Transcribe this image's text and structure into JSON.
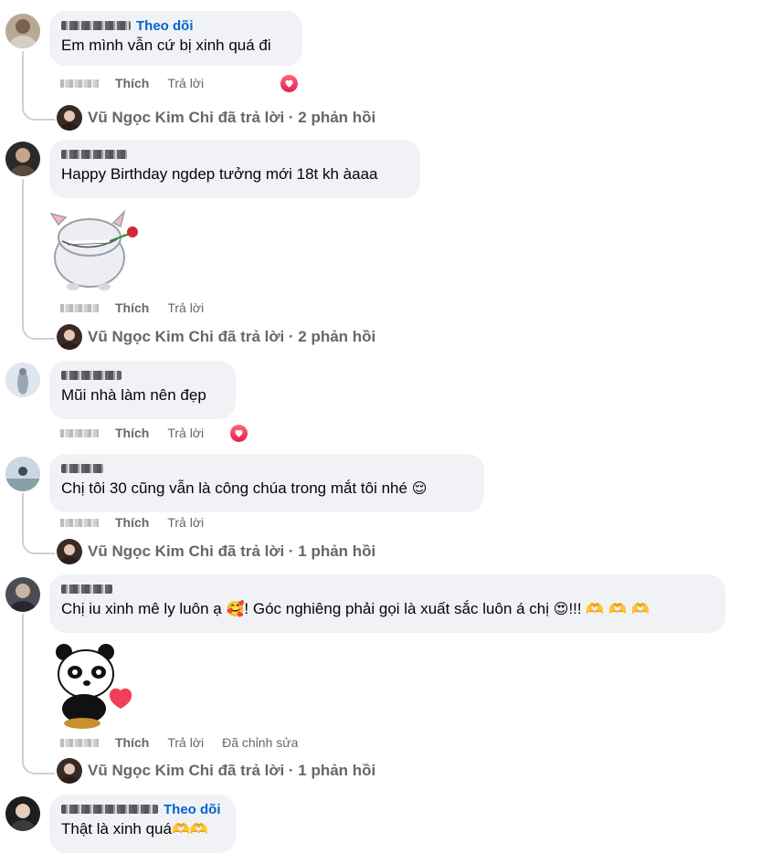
{
  "comments": [
    {
      "text": "Em mình vẫn cứ bị xinh quá đi",
      "follow": "Theo dõi",
      "like": "Thích",
      "reply": "Trả lời"
    },
    {
      "text": "Happy Birthday ngdep tưởng mới 18t kh àaaa",
      "like": "Thích",
      "reply": "Trả lời"
    },
    {
      "text": "Mũi nhà làm nên đẹp",
      "like": "Thích",
      "reply": "Trả lời"
    },
    {
      "text": "Chị tôi 30 cũng vẫn là công chúa trong mắt tôi nhé",
      "emoji": "😌",
      "like": "Thích",
      "reply": "Trả lời"
    },
    {
      "text_a": "Chị iu xinh mê ly luôn ạ",
      "emoji_a": "🥰",
      "text_b": "! Góc nghiêng phải gọi là xuất sắc luôn á chị",
      "emoji_b": "😍",
      "text_c": "!!!",
      "emoji_c": "🫶 🫶 🫶",
      "like": "Thích",
      "reply": "Trả lời",
      "edited": "Đã chỉnh sửa"
    },
    {
      "text": "Thật là xinh quá",
      "emoji": "🫶🫶",
      "follow": "Theo dõi"
    }
  ],
  "replies": [
    {
      "label": "Vũ Ngọc Kim Chi đã trả lời · 2 phản hồi"
    },
    {
      "label": "Vũ Ngọc Kim Chi đã trả lời · 2 phản hồi"
    },
    {
      "label": "Vũ Ngọc Kim Chi đã trả lời · 1 phản hồi"
    },
    {
      "label": "Vũ Ngọc Kim Chi đã trả lời · 1 phản hồi"
    }
  ],
  "icons": {
    "reaction": "heart-reaction-icon",
    "sticker1": "sheep-with-rose-sticker",
    "sticker2": "panda-with-heart-sticker"
  },
  "colors": {
    "follow": "#0064d1",
    "bubble": "#f0f2f5",
    "meta": "#65676b",
    "heart": "#f33e58"
  }
}
